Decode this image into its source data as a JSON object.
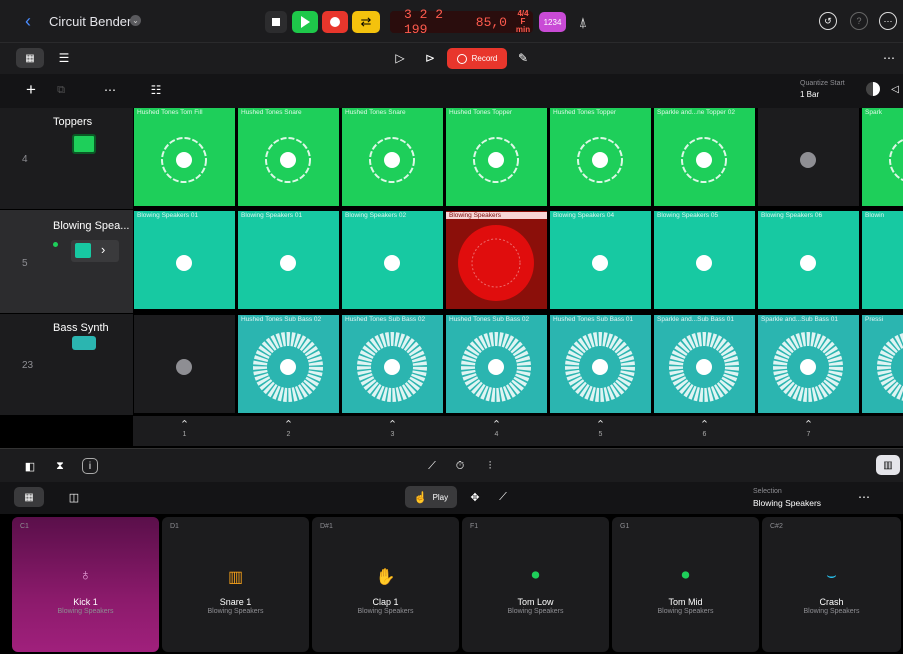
{
  "header": {
    "project_title": "Circuit Bender",
    "lcd_position": "3 2 2 199",
    "lcd_tempo": "85,0",
    "lcd_sig_top": "4/4",
    "lcd_sig_bottom": "F min",
    "count_in": "1234"
  },
  "toolbar2": {
    "record_label": "Record"
  },
  "tracks_bar": {
    "quantize_label": "Quantize Start",
    "quantize_value": "1 Bar"
  },
  "tracks": [
    {
      "num": "4",
      "name": "Toppers"
    },
    {
      "num": "5",
      "name": "Blowing Spea..."
    },
    {
      "num": "23",
      "name": "Bass Synth"
    }
  ],
  "rows": [
    {
      "color": "#1ecf5a",
      "cells": [
        "Hushed Tones Tom Fill",
        "Hushed Tones Snare",
        "Hushed Tones Snare",
        "Hushed Tones Topper",
        "Hushed Tones Topper",
        "Sparkle and...ne Topper 02",
        "",
        "Spark"
      ]
    },
    {
      "color": "#17c9a2",
      "cells": [
        "Blowing Speakers 01",
        "Blowing Speakers 01",
        "Blowing Speakers 02",
        "Blowing Speakers",
        "Blowing Speakers 04",
        "Blowing Speakers 05",
        "Blowing Speakers 06",
        "Blowin"
      ]
    },
    {
      "color": "#2bb5b0",
      "cells": [
        "",
        "Hushed Tones Sub Bass 02",
        "Hushed Tones Sub Bass 02",
        "Hushed Tones Sub Bass 02",
        "Hushed Tones Sub Bass 01",
        "Sparkle and...Sub Bass 01",
        "Sparkle and...Sub Bass 01",
        "Pressi"
      ]
    }
  ],
  "scene_numbers": [
    "1",
    "2",
    "3",
    "4",
    "5",
    "6",
    "7"
  ],
  "editor": {
    "play_label": "Play",
    "selection_label": "Selection",
    "selection_value": "Blowing Speakers"
  },
  "pads": [
    {
      "note": "C1",
      "name": "Kick 1",
      "sub": "Blowing Speakers",
      "icon": "kick-icon",
      "color": "#8b1a6b"
    },
    {
      "note": "D1",
      "name": "Snare 1",
      "sub": "Blowing Speakers",
      "icon": "snare-icon",
      "color": "#1c1c1e"
    },
    {
      "note": "D#1",
      "name": "Clap 1",
      "sub": "Blowing Speakers",
      "icon": "clap-icon",
      "color": "#1c1c1e"
    },
    {
      "note": "F1",
      "name": "Tom Low",
      "sub": "Blowing Speakers",
      "icon": "tom-low-icon",
      "color": "#1c1c1e"
    },
    {
      "note": "G1",
      "name": "Tom Mid",
      "sub": "Blowing Speakers",
      "icon": "tom-mid-icon",
      "color": "#1c1c1e"
    },
    {
      "note": "C#2",
      "name": "Crash",
      "sub": "Blowing Speakers",
      "icon": "crash-icon",
      "color": "#1c1c1e"
    }
  ],
  "colors": {
    "accent_record": "#e8362c",
    "accent_play": "#1ec84a",
    "accent_loop": "#f4c20d"
  }
}
